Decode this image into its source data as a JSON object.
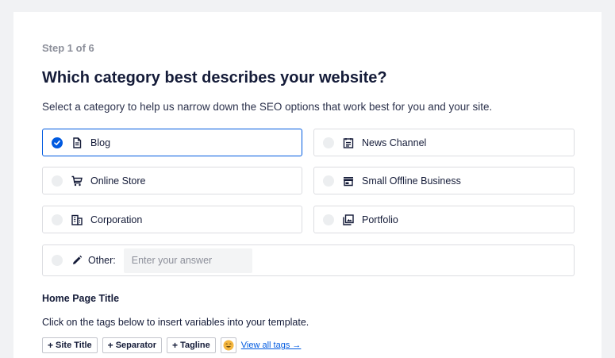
{
  "wizard": {
    "step_label": "Step 1 of 6",
    "title": "Which category best describes your website?",
    "subtitle": "Select a category to help us narrow down the SEO options that work best for you and your site."
  },
  "categories": [
    {
      "label": "Blog",
      "icon": "document-icon",
      "selected": true
    },
    {
      "label": "News Channel",
      "icon": "newspaper-icon",
      "selected": false
    },
    {
      "label": "Online Store",
      "icon": "cart-icon",
      "selected": false
    },
    {
      "label": "Small Offline Business",
      "icon": "storefront-icon",
      "selected": false
    },
    {
      "label": "Corporation",
      "icon": "building-icon",
      "selected": false
    },
    {
      "label": "Portfolio",
      "icon": "gallery-icon",
      "selected": false
    }
  ],
  "other": {
    "label": "Other:",
    "icon": "pencil-icon",
    "placeholder": "Enter your answer",
    "value": ""
  },
  "home_title": {
    "heading": "Home Page Title",
    "description": "Click on the tags below to insert variables into your template.",
    "tags": [
      "Site Title",
      "Separator",
      "Tagline"
    ],
    "emoji_icon": "smiley-emoji-icon",
    "view_all_label": "View all tags →"
  },
  "colors": {
    "accent": "#005ae0",
    "text": "#141b38",
    "muted": "#8c8f9a",
    "border": "#dcdde1",
    "background": "#f1f2f4"
  }
}
